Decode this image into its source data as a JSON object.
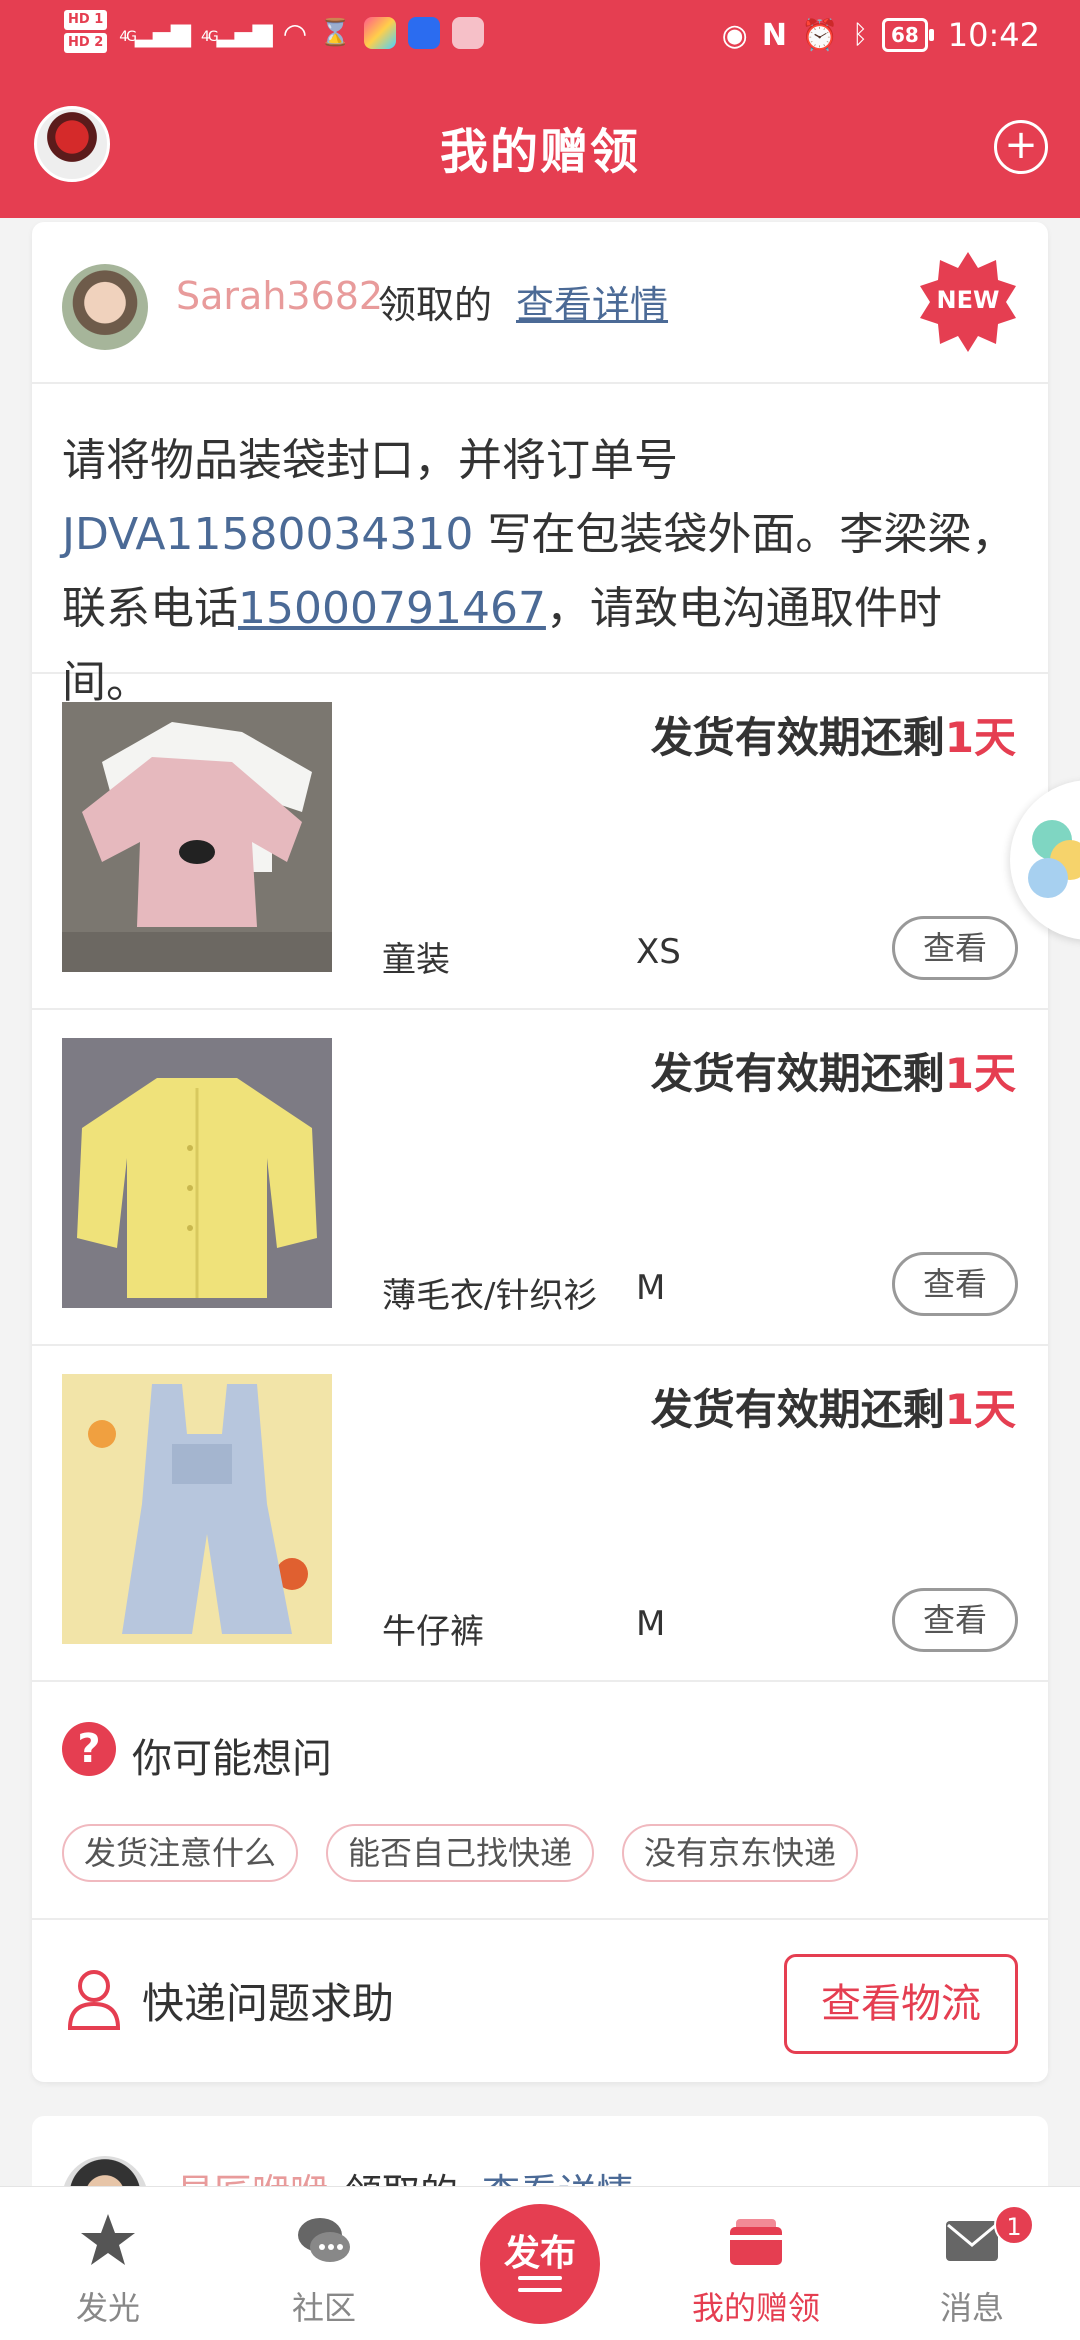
{
  "status_bar": {
    "hd1": "HD 1",
    "hd2": "HD 2",
    "net1": "4G",
    "net2": "4G",
    "battery": "68",
    "time": "10:42"
  },
  "header": {
    "title": "我的赠领"
  },
  "card": {
    "user_name": "Sarah3682",
    "claim_text": "领取的",
    "detail_link": "查看详情",
    "new_badge": "NEW",
    "notice": {
      "part1": "请将物品装袋封口，并将订单号 ",
      "order_no": "JDVA11580034310",
      "part2": " 写在包装袋外面。李梁梁，联系电话",
      "phone": "15000791467",
      "part3": "，请致电沟通取件时间。"
    },
    "items": [
      {
        "deadline_prefix": "发货有效期还剩",
        "deadline_value": "1天",
        "category": "童装",
        "size": "XS",
        "view": "查看"
      },
      {
        "deadline_prefix": "发货有效期还剩",
        "deadline_value": "1天",
        "category": "薄毛衣/针织衫",
        "size": "M",
        "view": "查看"
      },
      {
        "deadline_prefix": "发货有效期还剩",
        "deadline_value": "1天",
        "category": "牛仔裤",
        "size": "M",
        "view": "查看"
      }
    ],
    "faq": {
      "icon": "?",
      "title": "你可能想问",
      "chips": [
        "发货注意什么",
        "能否自己找快递",
        "没有京东快递"
      ]
    },
    "help": {
      "text": "快递问题求助",
      "button": "查看物流"
    }
  },
  "card2": {
    "user_name": "易匠咿咿",
    "claim_text": "领取的",
    "detail_link": "查看详情"
  },
  "nav": {
    "items": [
      {
        "label": "发光",
        "icon": "star-icon"
      },
      {
        "label": "社区",
        "icon": "chat-bubble-icon"
      },
      {
        "label": "我的赠领",
        "icon": "gift-cards-icon"
      },
      {
        "label": "消息",
        "icon": "mail-icon",
        "badge": "1"
      }
    ],
    "publish": "发布"
  },
  "colors": {
    "brand_red": "#e53e51",
    "link_blue": "#4b6a96",
    "username_pink": "#e89b9b"
  }
}
